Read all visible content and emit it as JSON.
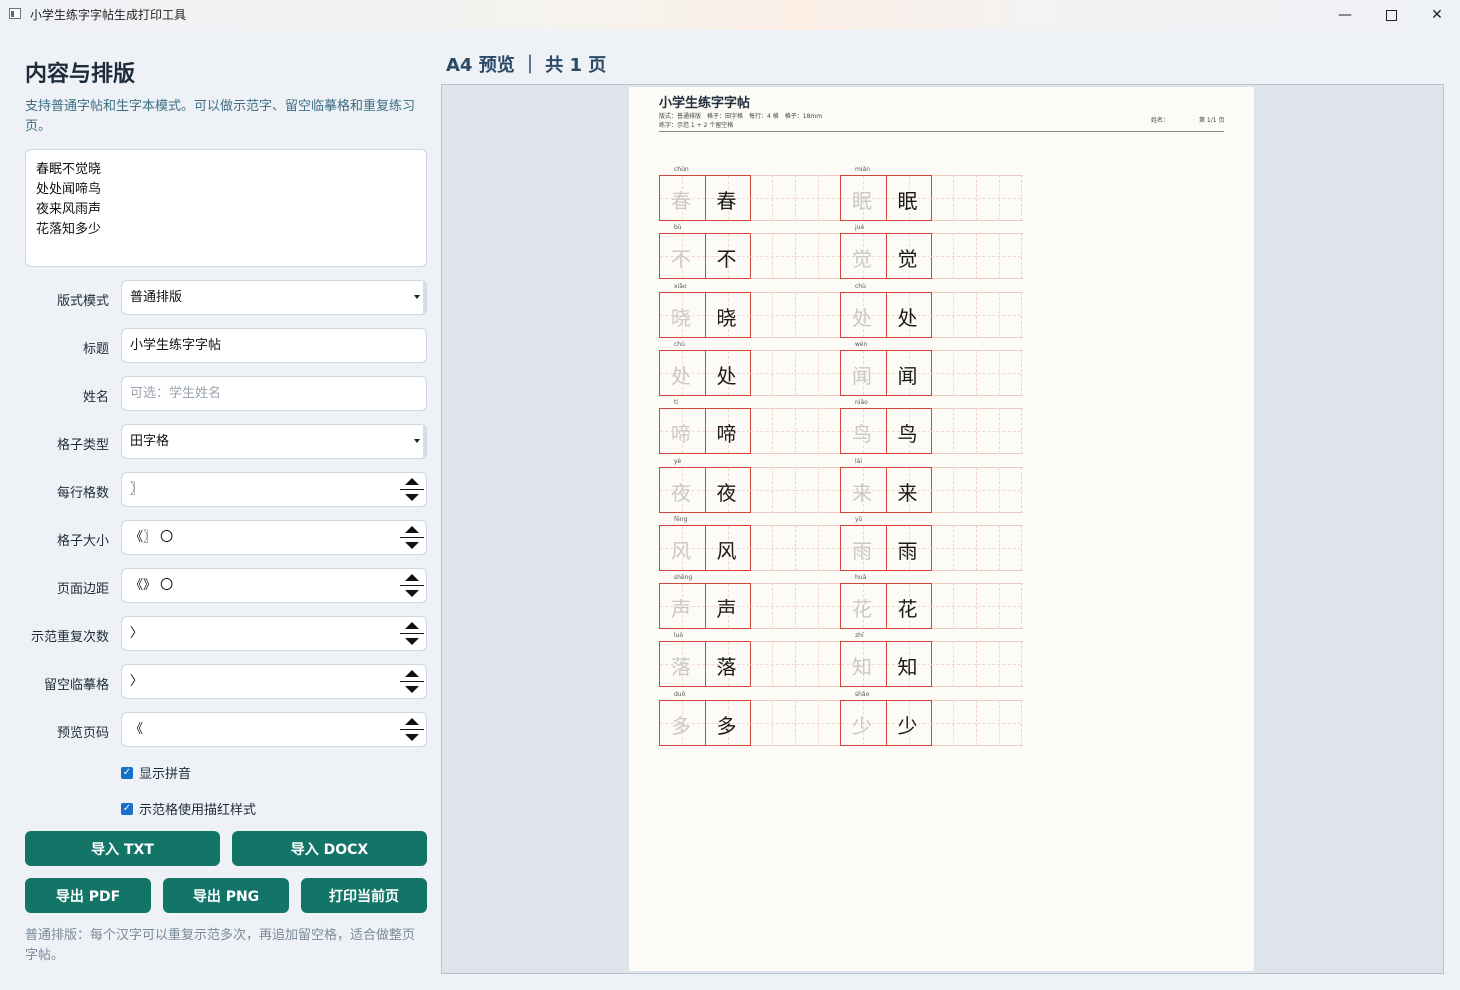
{
  "window": {
    "title": "小学生练字字帖生成打印工具"
  },
  "panel": {
    "title": "内容与排版",
    "description": "支持普通字帖和生字本模式。可以做示范字、留空临摹格和重复练习页。",
    "text_lines": [
      "春眠不觉晓",
      "处处闻啼鸟",
      "夜来风雨声",
      "花落知多少"
    ]
  },
  "form": {
    "layout_mode": {
      "label": "版式模式",
      "value": "普通排版"
    },
    "title": {
      "label": "标题",
      "value": "小学生练字字帖"
    },
    "name": {
      "label": "姓名",
      "value": "",
      "placeholder": "可选：学生姓名"
    },
    "grid_type": {
      "label": "格子类型",
      "value": "田字格"
    },
    "cells_per_row": {
      "label": "每行格数",
      "value": "〗"
    },
    "cell_size": {
      "label": "格子大小",
      "value": "《〗 〇"
    },
    "page_margin": {
      "label": "页面边距",
      "value": "《》 〇"
    },
    "demo_repeat": {
      "label": "示范重复次数",
      "value": "〉"
    },
    "blank_cells": {
      "label": "留空临摹格",
      "value": "〉"
    },
    "preview_page": {
      "label": "预览页码",
      "value": "《"
    },
    "show_pinyin": {
      "label": "显示拼音",
      "checked": true
    },
    "trace_style": {
      "label": "示范格使用描红样式",
      "checked": true
    }
  },
  "buttons": {
    "import_txt": "导入 TXT",
    "import_docx": "导入 DOCX",
    "export_pdf": "导出 PDF",
    "export_png": "导出 PNG",
    "print_page": "打印当前页"
  },
  "footnote": "普通排版：每个汉字可以重复示范多次，再追加留空格，适合做整页字帖。",
  "preview": {
    "header": "A4 预览 ｜ 共 1 页",
    "paper_title": "小学生练字字帖",
    "meta_line1": "版式：普通排版　格子：田字格　每行：4 格　格子：18mm",
    "meta_line2": "练字：示范 1 + 2 个留空格",
    "name_label": "姓名：",
    "page_label": "第 1/1 页",
    "characters": [
      {
        "char": "春",
        "pinyin": "chūn"
      },
      {
        "char": "眠",
        "pinyin": "mián"
      },
      {
        "char": "不",
        "pinyin": "bù"
      },
      {
        "char": "觉",
        "pinyin": "jué"
      },
      {
        "char": "晓",
        "pinyin": "xiǎo"
      },
      {
        "char": "处",
        "pinyin": "chù"
      },
      {
        "char": "处",
        "pinyin": "chù"
      },
      {
        "char": "闻",
        "pinyin": "wén"
      },
      {
        "char": "啼",
        "pinyin": "tí"
      },
      {
        "char": "鸟",
        "pinyin": "niǎo"
      },
      {
        "char": "夜",
        "pinyin": "yè"
      },
      {
        "char": "来",
        "pinyin": "lái"
      },
      {
        "char": "风",
        "pinyin": "fēng"
      },
      {
        "char": "雨",
        "pinyin": "yǔ"
      },
      {
        "char": "声",
        "pinyin": "shēng"
      },
      {
        "char": "花",
        "pinyin": "huā"
      },
      {
        "char": "落",
        "pinyin": "luò"
      },
      {
        "char": "知",
        "pinyin": "zhī"
      },
      {
        "char": "多",
        "pinyin": "duō"
      },
      {
        "char": "少",
        "pinyin": "shǎo"
      }
    ]
  },
  "colors": {
    "accent": "#137568",
    "grid_red": "#d2463a",
    "paper": "#fdfbf5"
  }
}
